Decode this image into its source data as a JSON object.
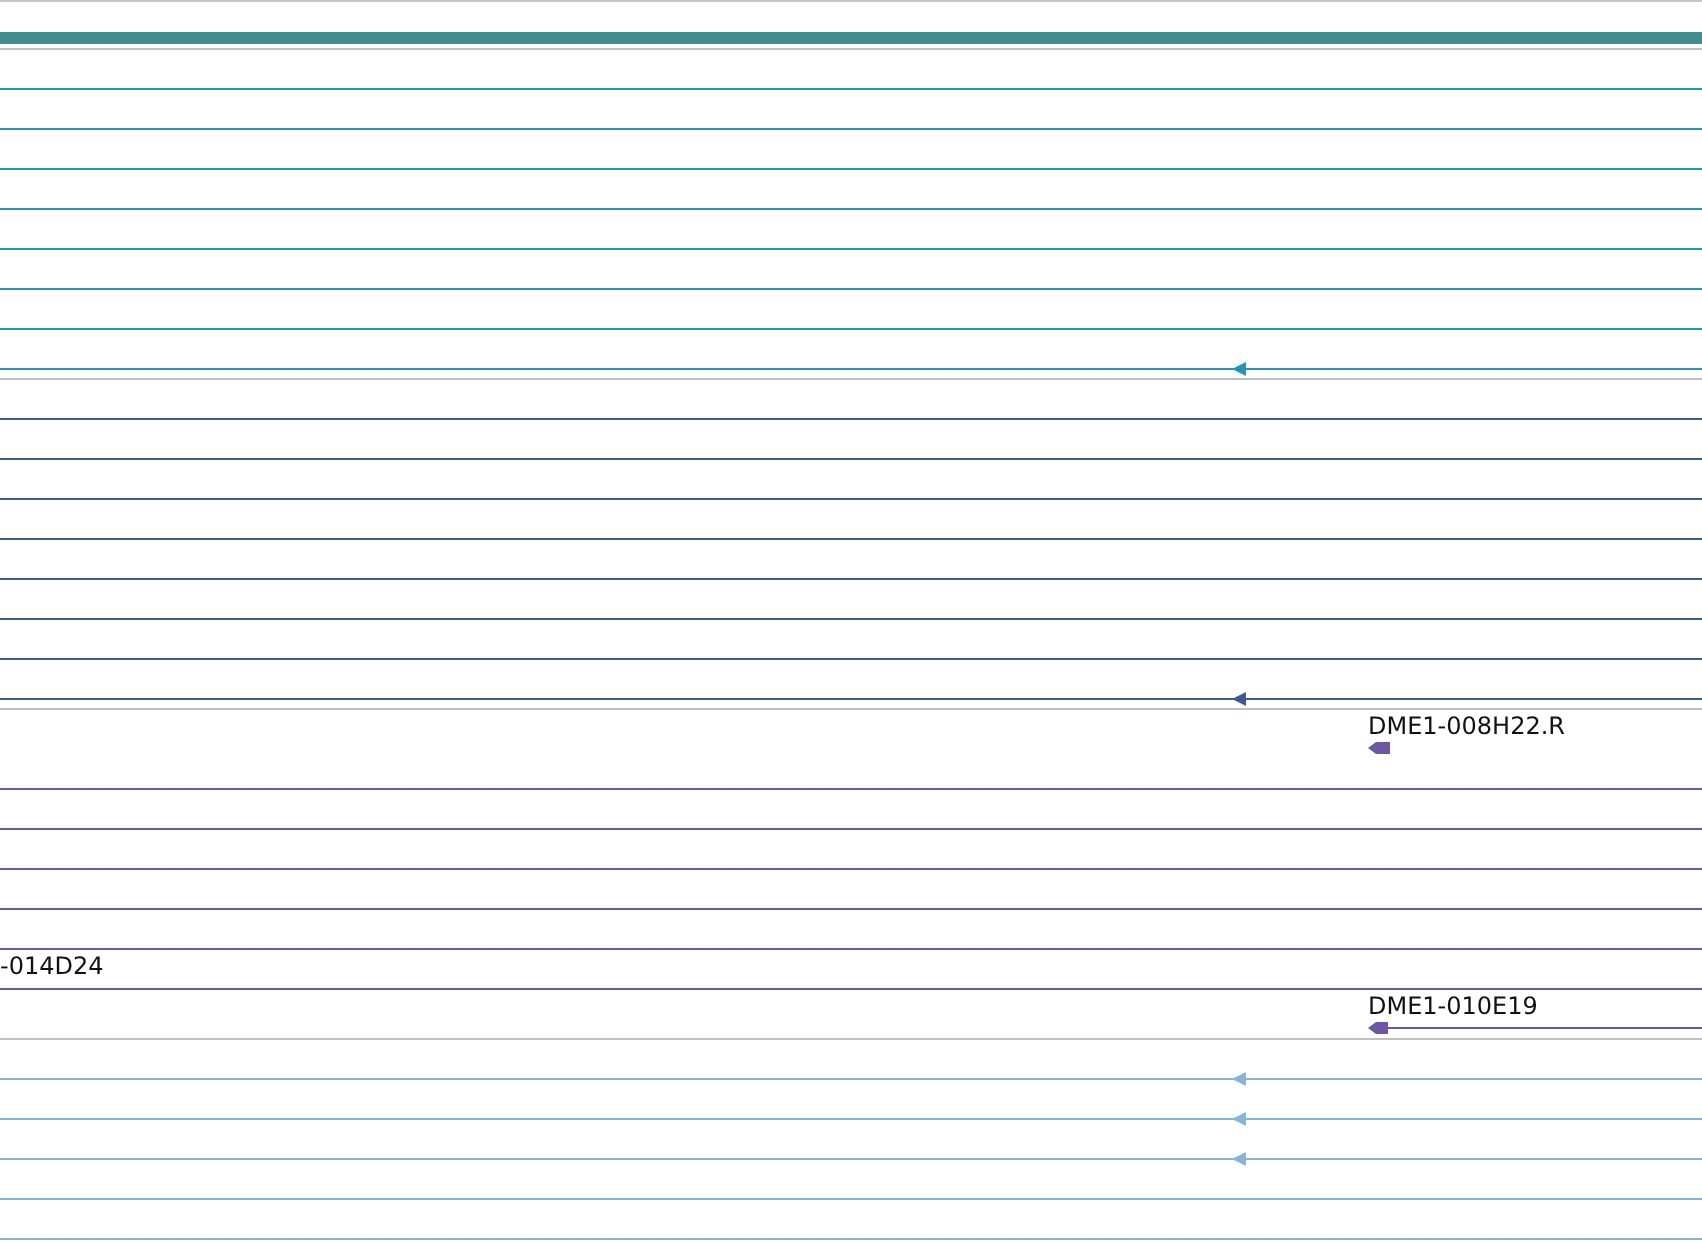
{
  "tracks": [
    {
      "color": "#2593b8",
      "features": [
        {
          "kind": "line",
          "arrow": false
        },
        {
          "kind": "line",
          "arrow": false
        },
        {
          "kind": "line",
          "arrow": false
        },
        {
          "kind": "line",
          "arrow": false
        },
        {
          "kind": "line",
          "arrow": false
        },
        {
          "kind": "line",
          "arrow": false
        },
        {
          "kind": "line",
          "arrow": false
        },
        {
          "kind": "line",
          "arrow": true
        }
      ]
    },
    {
      "color": "#3a5a90",
      "features": [
        {
          "kind": "line",
          "arrow": false
        },
        {
          "kind": "line",
          "arrow": false
        },
        {
          "kind": "line",
          "arrow": false
        },
        {
          "kind": "line",
          "arrow": false
        },
        {
          "kind": "line",
          "arrow": false
        },
        {
          "kind": "line",
          "arrow": false
        },
        {
          "kind": "line",
          "arrow": false
        },
        {
          "kind": "line",
          "arrow": true
        }
      ]
    },
    {
      "color": "#6e56a4",
      "features": [
        {
          "kind": "glyph",
          "label": "DME1-008H22.R"
        },
        {
          "kind": "line",
          "arrow": false
        },
        {
          "kind": "line",
          "arrow": false
        },
        {
          "kind": "line",
          "arrow": false
        },
        {
          "kind": "line",
          "arrow": false
        },
        {
          "kind": "line",
          "arrow": false
        },
        {
          "kind": "line",
          "arrow": false,
          "label": "-014D24"
        },
        {
          "kind": "partial",
          "label": "DME1-010E19"
        }
      ]
    },
    {
      "color": "#85b6da",
      "features": [
        {
          "kind": "line",
          "arrow": true
        },
        {
          "kind": "line",
          "arrow": true
        },
        {
          "kind": "line",
          "arrow": true
        },
        {
          "kind": "line",
          "arrow": false
        },
        {
          "kind": "line",
          "arrow": false
        }
      ]
    }
  ]
}
